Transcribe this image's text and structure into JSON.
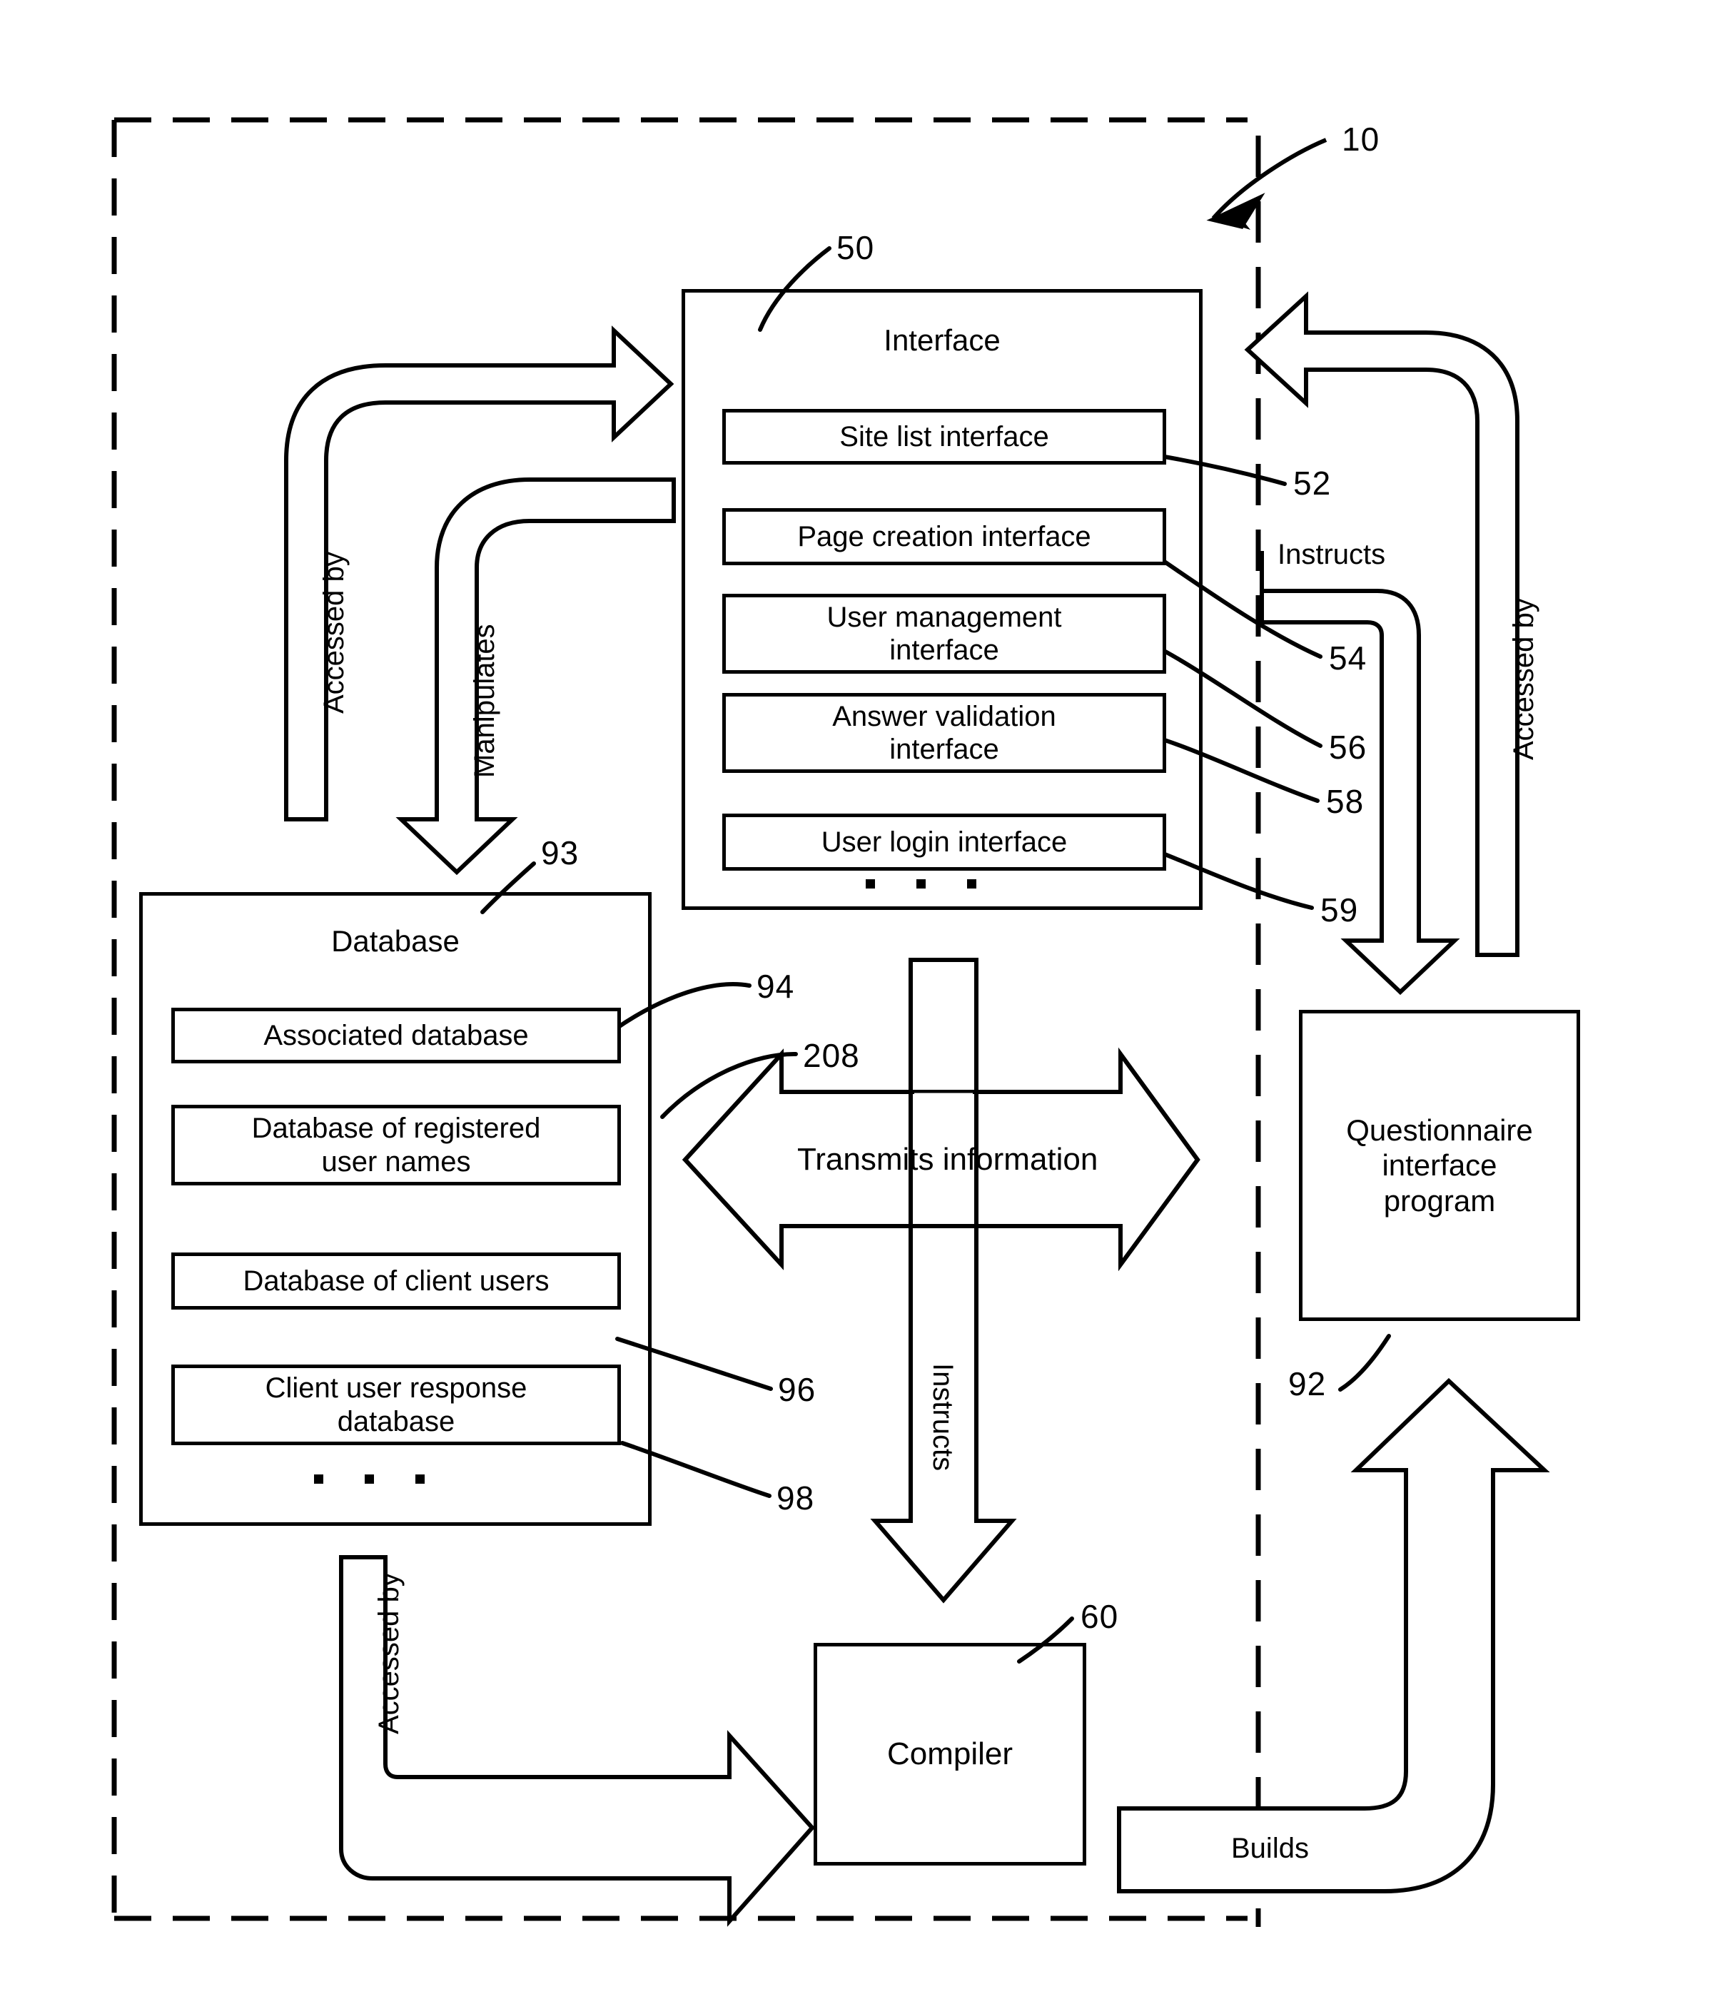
{
  "figure": {
    "top_reference": "10"
  },
  "interface_group": {
    "title": "Interface",
    "reference": "50",
    "items": [
      {
        "label": "Site list interface",
        "reference": "52"
      },
      {
        "label": "Page creation interface",
        "reference": "54"
      },
      {
        "label": "User management\ninterface",
        "reference": "56"
      },
      {
        "label": "Answer validation\ninterface",
        "reference": "58"
      },
      {
        "label": "User login interface",
        "reference": "59"
      }
    ],
    "continuation_marker": "• • •"
  },
  "database_group": {
    "title": "Database",
    "reference": "93",
    "items": [
      {
        "label": "Associated database",
        "reference": "94"
      },
      {
        "label": "Database of registered\nuser names",
        "reference": "96"
      },
      {
        "label": "Database of client users",
        "reference": "98"
      },
      {
        "label": "Client user response\ndatabase",
        "reference": ""
      }
    ],
    "continuation_marker": "• • •"
  },
  "questionnaire_program": {
    "label": "Questionnaire\ninterface\nprogram",
    "reference": "92"
  },
  "compiler": {
    "label": "Compiler",
    "reference": "60"
  },
  "arrows": {
    "accessed_by_left": "Accessed by",
    "manipulates": "Manipulates",
    "instructs_right": "Instructs",
    "accessed_by_right": "Accessed by",
    "transmits_information": "Transmits information",
    "transmits_reference": "208",
    "instructs_down": "Instructs",
    "accessed_by_bottom": "Accessed by",
    "builds": "Builds"
  },
  "colors": {
    "stroke": "#000000",
    "background": "#ffffff"
  }
}
